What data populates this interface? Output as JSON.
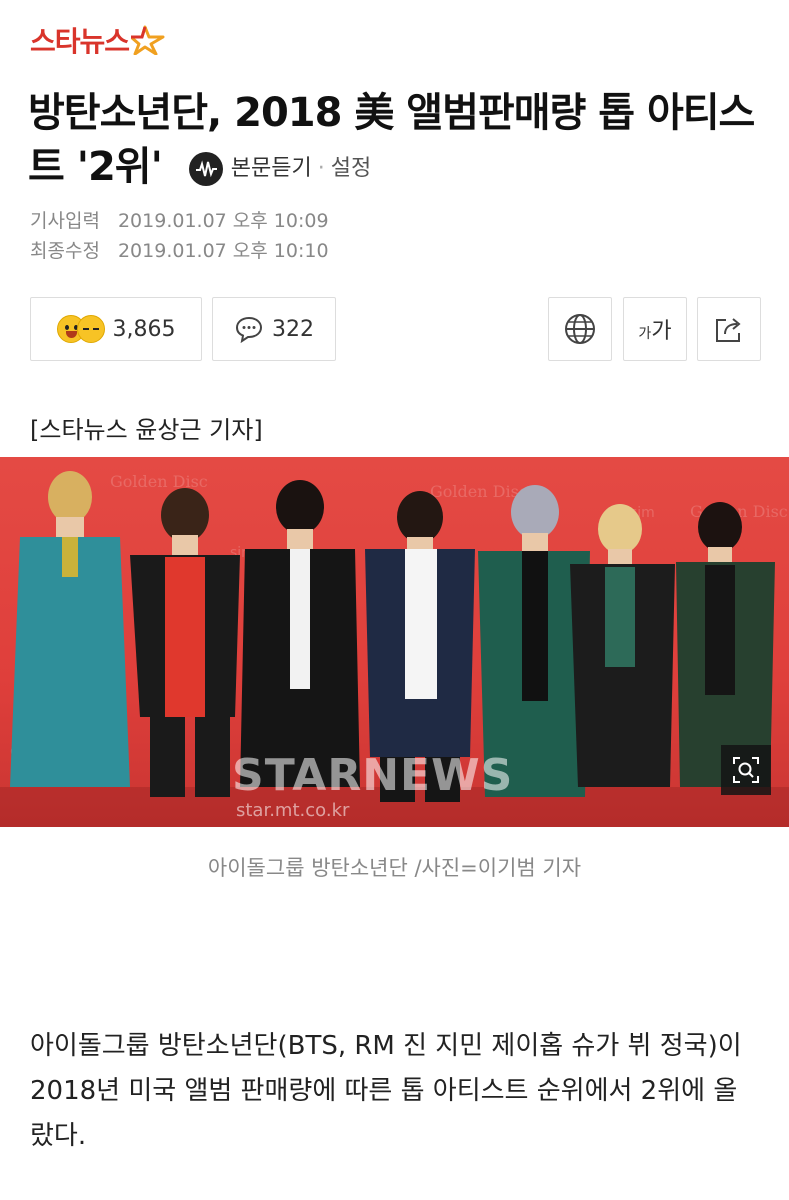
{
  "header": {
    "logo_text": "스타뉴스",
    "brand_color": "#d9342b",
    "accent_color": "#f0a020"
  },
  "article": {
    "title": "방탄소년단, 2018 美 앨범판매량 톱 아티스트 '2위'",
    "listen_label": "본문듣기",
    "listen_icon": "audio-icon",
    "separator": "·",
    "settings_label": "설정",
    "published_label": "기사입력",
    "published_value": "2019.01.07 오후 10:09",
    "modified_label": "최종수정",
    "modified_value": "2019.01.07 오후 10:10",
    "reporter": "[스타뉴스 윤상근 기자]",
    "photo_watermark": "STARNEWS",
    "photo_watermark_sub": "star.mt.co.kr",
    "photo_caption": "아이돌그룹 방탄소년단 /사진=이기범 기자",
    "body": "아이돌그룹 방탄소년단(BTS, RM 진 지민 제이홉 슈가 뷔 정국)이 2018년 미국 앨범 판매량에 따른 톱 아티스트 순위에서 2위에 올랐다."
  },
  "toolbar": {
    "reaction_count": "3,865",
    "comment_count": "322",
    "font_small": "가",
    "font_large": "가",
    "icons": [
      "smile-emoji-icon",
      "sleepy-emoji-icon",
      "comment-bubble-icon",
      "globe-icon",
      "font-size-icon",
      "share-icon",
      "zoom-icon"
    ]
  }
}
